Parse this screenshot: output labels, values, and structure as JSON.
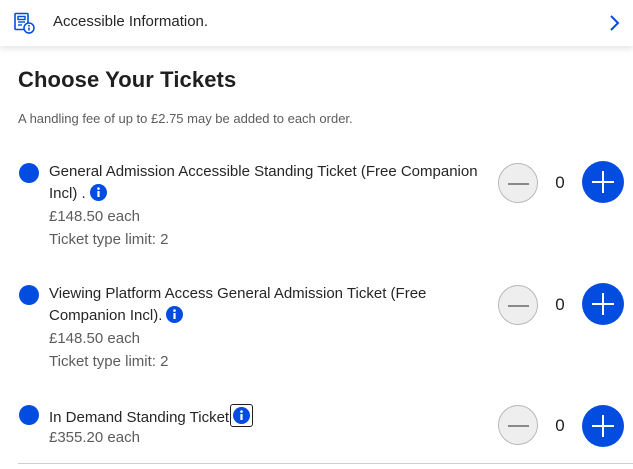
{
  "accessible_bar": {
    "label": "Accessible Information.",
    "icon": "accessible-document-icon",
    "chevron": "chevron-right-icon"
  },
  "section": {
    "title": "Choose Your Tickets",
    "fee_note": "A handling fee of up to £2.75 may be added to each order."
  },
  "tickets": [
    {
      "name": "General Admission Accessible Standing Ticket (Free Companion Incl) .",
      "price": "£148.50 each",
      "limit": "Ticket type limit: 2",
      "quantity": "0"
    },
    {
      "name": "Viewing Platform Access General Admission Ticket (Free Companion Incl).",
      "price": "£148.50 each",
      "limit": "Ticket type limit: 2",
      "quantity": "0"
    },
    {
      "name": "In Demand Standing Ticket",
      "price": "£355.20 each",
      "limit": "",
      "quantity": "0"
    }
  ],
  "colors": {
    "accent": "#024ddf",
    "text": "#262626",
    "muted": "#5c5c5c"
  }
}
